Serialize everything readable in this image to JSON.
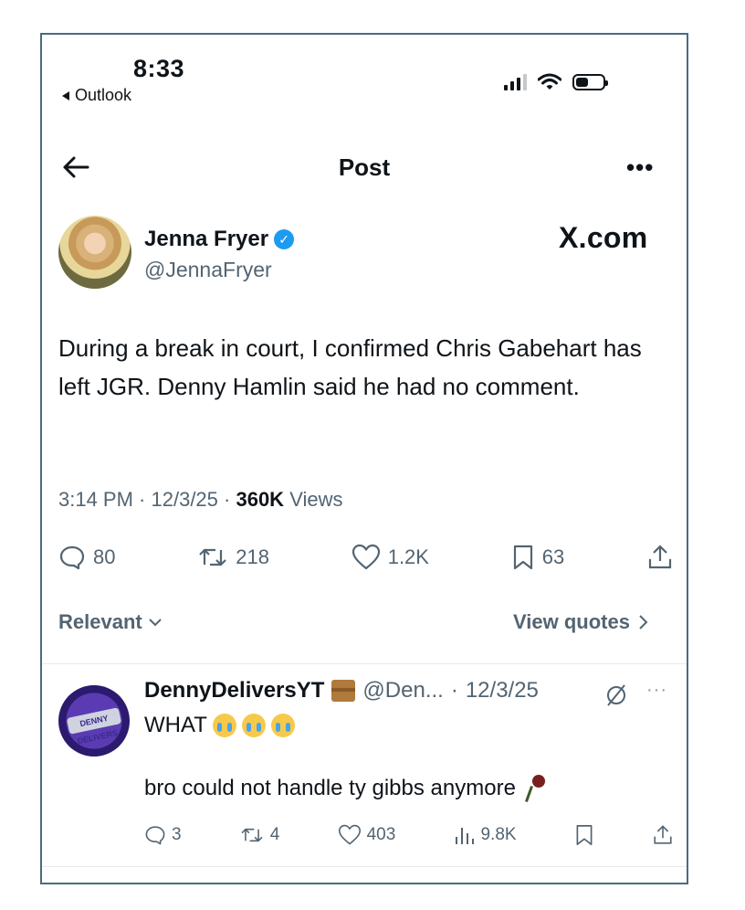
{
  "status_bar": {
    "time": "8:33",
    "back_app_label": "Outlook"
  },
  "nav": {
    "title": "Post",
    "more": "•••"
  },
  "post": {
    "author_name": "Jenna Fryer",
    "author_handle": "@JennaFryer",
    "watermark": "X.com",
    "text": "During a break in court, I confirmed Chris Gabehart has left JGR. Denny Hamlin said he had no comment.",
    "time": "3:14 PM",
    "date": "12/3/25",
    "views_count": "360K",
    "views_label": "Views",
    "replies": "80",
    "reposts": "218",
    "likes": "1.2K",
    "bookmarks": "63"
  },
  "filter": {
    "relevant_label": "Relevant",
    "view_quotes_label": "View quotes"
  },
  "reply": {
    "name": "DennyDeliversYT",
    "handle": "@Den...",
    "date": "12/3/25",
    "text1": "WHAT",
    "text2": "bro could not handle ty gibbs anymore",
    "avatar_text": "DENNY DELIVERS",
    "replies": "3",
    "reposts": "4",
    "likes": "403",
    "views": "9.8K",
    "more": "···"
  },
  "colors": {
    "text_primary": "#0f1419",
    "text_secondary": "#536471",
    "verified_blue": "#1d9bf0",
    "frame_border": "#4a6b80"
  }
}
